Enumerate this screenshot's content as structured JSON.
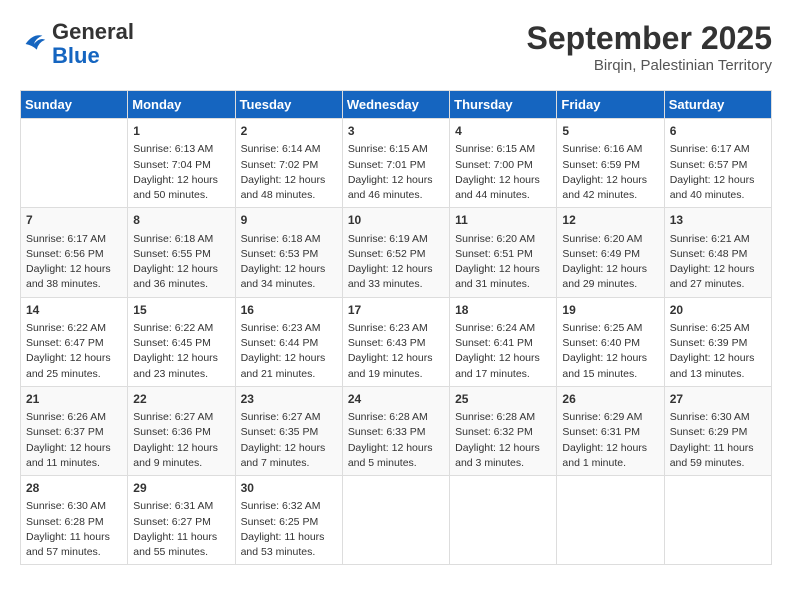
{
  "header": {
    "logo_general": "General",
    "logo_blue": "Blue",
    "month_title": "September 2025",
    "subtitle": "Birqin, Palestinian Territory"
  },
  "days_of_week": [
    "Sunday",
    "Monday",
    "Tuesday",
    "Wednesday",
    "Thursday",
    "Friday",
    "Saturday"
  ],
  "weeks": [
    [
      {
        "day": "",
        "content": ""
      },
      {
        "day": "1",
        "content": "Sunrise: 6:13 AM\nSunset: 7:04 PM\nDaylight: 12 hours and 50 minutes."
      },
      {
        "day": "2",
        "content": "Sunrise: 6:14 AM\nSunset: 7:02 PM\nDaylight: 12 hours and 48 minutes."
      },
      {
        "day": "3",
        "content": "Sunrise: 6:15 AM\nSunset: 7:01 PM\nDaylight: 12 hours and 46 minutes."
      },
      {
        "day": "4",
        "content": "Sunrise: 6:15 AM\nSunset: 7:00 PM\nDaylight: 12 hours and 44 minutes."
      },
      {
        "day": "5",
        "content": "Sunrise: 6:16 AM\nSunset: 6:59 PM\nDaylight: 12 hours and 42 minutes."
      },
      {
        "day": "6",
        "content": "Sunrise: 6:17 AM\nSunset: 6:57 PM\nDaylight: 12 hours and 40 minutes."
      }
    ],
    [
      {
        "day": "7",
        "content": "Sunrise: 6:17 AM\nSunset: 6:56 PM\nDaylight: 12 hours and 38 minutes."
      },
      {
        "day": "8",
        "content": "Sunrise: 6:18 AM\nSunset: 6:55 PM\nDaylight: 12 hours and 36 minutes."
      },
      {
        "day": "9",
        "content": "Sunrise: 6:18 AM\nSunset: 6:53 PM\nDaylight: 12 hours and 34 minutes."
      },
      {
        "day": "10",
        "content": "Sunrise: 6:19 AM\nSunset: 6:52 PM\nDaylight: 12 hours and 33 minutes."
      },
      {
        "day": "11",
        "content": "Sunrise: 6:20 AM\nSunset: 6:51 PM\nDaylight: 12 hours and 31 minutes."
      },
      {
        "day": "12",
        "content": "Sunrise: 6:20 AM\nSunset: 6:49 PM\nDaylight: 12 hours and 29 minutes."
      },
      {
        "day": "13",
        "content": "Sunrise: 6:21 AM\nSunset: 6:48 PM\nDaylight: 12 hours and 27 minutes."
      }
    ],
    [
      {
        "day": "14",
        "content": "Sunrise: 6:22 AM\nSunset: 6:47 PM\nDaylight: 12 hours and 25 minutes."
      },
      {
        "day": "15",
        "content": "Sunrise: 6:22 AM\nSunset: 6:45 PM\nDaylight: 12 hours and 23 minutes."
      },
      {
        "day": "16",
        "content": "Sunrise: 6:23 AM\nSunset: 6:44 PM\nDaylight: 12 hours and 21 minutes."
      },
      {
        "day": "17",
        "content": "Sunrise: 6:23 AM\nSunset: 6:43 PM\nDaylight: 12 hours and 19 minutes."
      },
      {
        "day": "18",
        "content": "Sunrise: 6:24 AM\nSunset: 6:41 PM\nDaylight: 12 hours and 17 minutes."
      },
      {
        "day": "19",
        "content": "Sunrise: 6:25 AM\nSunset: 6:40 PM\nDaylight: 12 hours and 15 minutes."
      },
      {
        "day": "20",
        "content": "Sunrise: 6:25 AM\nSunset: 6:39 PM\nDaylight: 12 hours and 13 minutes."
      }
    ],
    [
      {
        "day": "21",
        "content": "Sunrise: 6:26 AM\nSunset: 6:37 PM\nDaylight: 12 hours and 11 minutes."
      },
      {
        "day": "22",
        "content": "Sunrise: 6:27 AM\nSunset: 6:36 PM\nDaylight: 12 hours and 9 minutes."
      },
      {
        "day": "23",
        "content": "Sunrise: 6:27 AM\nSunset: 6:35 PM\nDaylight: 12 hours and 7 minutes."
      },
      {
        "day": "24",
        "content": "Sunrise: 6:28 AM\nSunset: 6:33 PM\nDaylight: 12 hours and 5 minutes."
      },
      {
        "day": "25",
        "content": "Sunrise: 6:28 AM\nSunset: 6:32 PM\nDaylight: 12 hours and 3 minutes."
      },
      {
        "day": "26",
        "content": "Sunrise: 6:29 AM\nSunset: 6:31 PM\nDaylight: 12 hours and 1 minute."
      },
      {
        "day": "27",
        "content": "Sunrise: 6:30 AM\nSunset: 6:29 PM\nDaylight: 11 hours and 59 minutes."
      }
    ],
    [
      {
        "day": "28",
        "content": "Sunrise: 6:30 AM\nSunset: 6:28 PM\nDaylight: 11 hours and 57 minutes."
      },
      {
        "day": "29",
        "content": "Sunrise: 6:31 AM\nSunset: 6:27 PM\nDaylight: 11 hours and 55 minutes."
      },
      {
        "day": "30",
        "content": "Sunrise: 6:32 AM\nSunset: 6:25 PM\nDaylight: 11 hours and 53 minutes."
      },
      {
        "day": "",
        "content": ""
      },
      {
        "day": "",
        "content": ""
      },
      {
        "day": "",
        "content": ""
      },
      {
        "day": "",
        "content": ""
      }
    ]
  ]
}
